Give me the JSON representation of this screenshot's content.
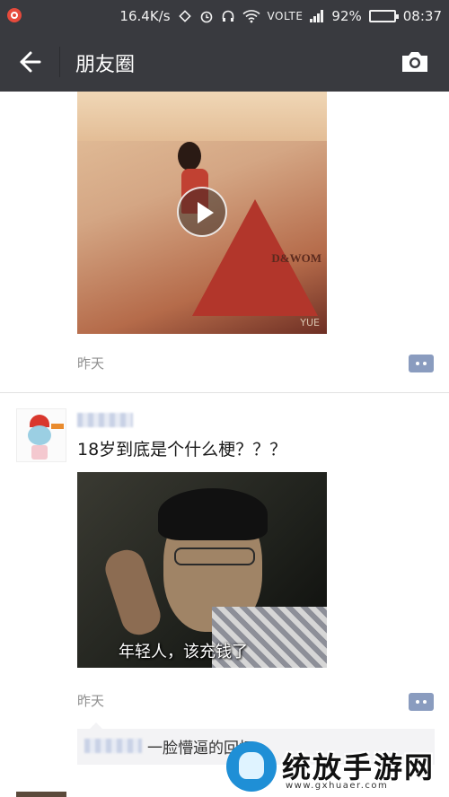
{
  "status_bar": {
    "network_speed": "16.4K/s",
    "network_type": "VOLTE",
    "battery": "92%",
    "battery_level": 0.92,
    "time": "08:37"
  },
  "title_bar": {
    "title": "朋友圈",
    "back_icon": "arrow-left-icon",
    "camera_icon": "camera-icon"
  },
  "post1": {
    "image_brand_text": "D&WOM",
    "image_watermark": "YUE",
    "time": "昨天"
  },
  "post2": {
    "text": "18岁到底是个什么梗？？？",
    "image_caption": "年轻人，该充钱了",
    "time": "昨天",
    "comment": {
      "text": "一脸懵逼的回忆"
    }
  },
  "watermark": {
    "site_name": "统放手游网",
    "site_url": "www.gxhuaer.com"
  },
  "colors": {
    "header_bg": "#393a3f",
    "comment_button": "#8a9cbf",
    "timestamp": "#8f8f8f"
  }
}
